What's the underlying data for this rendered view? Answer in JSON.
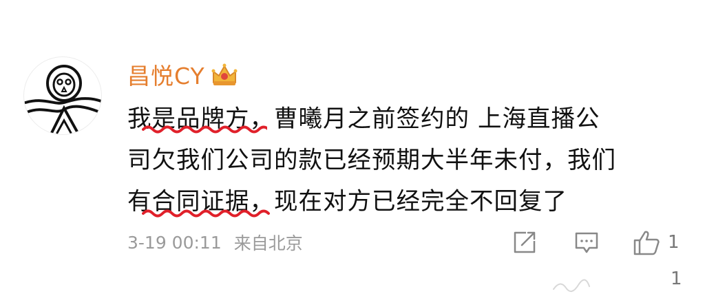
{
  "comment": {
    "username": "昌悦CY",
    "text_lines": [
      "我是品牌方，曹曦月之前签约的 上海直播公",
      "司欠我们公司的款已经预期大半年未付，我们",
      "有合同证据，现在对方已经完全不回复了"
    ],
    "time": "3-19 00:11",
    "location": "来自北京",
    "like_count": "1",
    "secondary_count": "1"
  },
  "icons": {
    "avatar": "owl-icon",
    "badge": "crown-icon",
    "share": "share-icon",
    "reply": "comment-icon",
    "like": "thumbs-up-icon"
  },
  "colors": {
    "username": "#e57e2e",
    "text": "#111111",
    "meta": "#9a9a9a",
    "underline": "#e0202a",
    "background": "#ffffff"
  }
}
